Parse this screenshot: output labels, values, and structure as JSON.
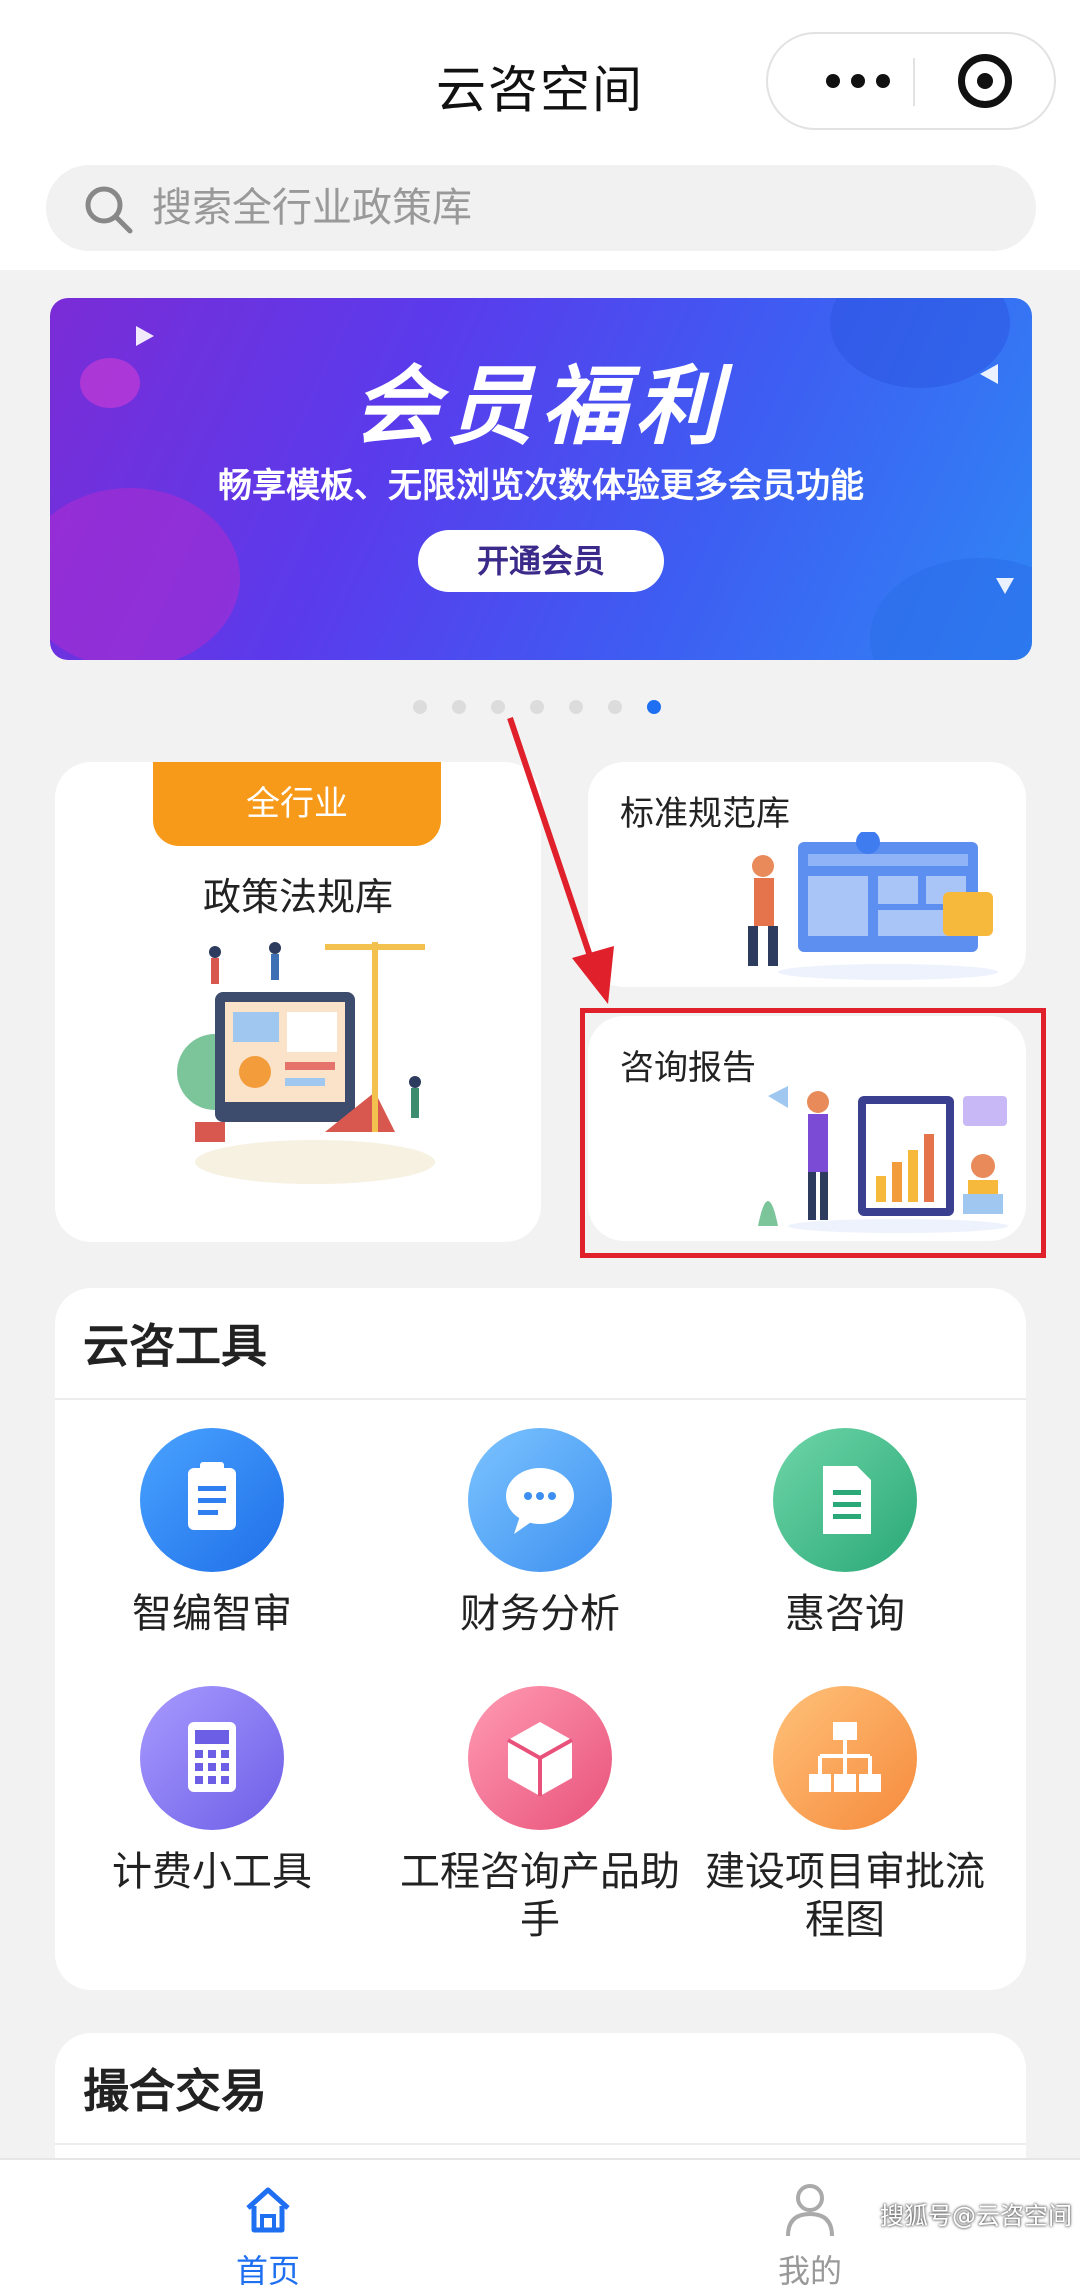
{
  "header": {
    "title": "云咨空间",
    "more_icon": "more-dots-icon",
    "close_icon": "target-circle-icon"
  },
  "search": {
    "placeholder": "搜索全行业政策库",
    "icon": "search-icon"
  },
  "banner": {
    "title": "会员福利",
    "subtitle": "畅享模板、无限浏览次数体验更多会员功能",
    "button_label": "开通会员",
    "pager_active_index": 7,
    "pager_count": 7
  },
  "cards": {
    "policy": {
      "tag": "全行业",
      "title": "政策法规库"
    },
    "standards": {
      "title": "标准规范库"
    },
    "report": {
      "title": "咨询报告"
    }
  },
  "tools": {
    "title": "云咨工具",
    "items": [
      {
        "label": "智编智审",
        "icon": "clipboard-icon",
        "color": "#2f7ff0"
      },
      {
        "label": "财务分析",
        "icon": "chat-bubble-icon",
        "color": "#4ea3f2"
      },
      {
        "label": "惠咨询",
        "icon": "document-icon",
        "color": "#3fbf8e"
      },
      {
        "label": "计费小工具",
        "icon": "calculator-icon",
        "color": "#8b7cf2"
      },
      {
        "label": "工程咨询产品助手",
        "icon": "cube-icon",
        "color": "#ef6a8a"
      },
      {
        "label": "建设项目审批流程图",
        "icon": "flowchart-icon",
        "color": "#f7a35a"
      }
    ]
  },
  "deals": {
    "title": "撮合交易"
  },
  "nav": {
    "home_label": "首页",
    "mine_label": "我的",
    "home_icon": "home-icon",
    "mine_icon": "user-icon"
  },
  "watermark": "搜狐号@云咨空间",
  "colors": {
    "accent": "#1e6ff1",
    "tag_orange": "#f79a19",
    "highlight_red": "#e0202a"
  }
}
